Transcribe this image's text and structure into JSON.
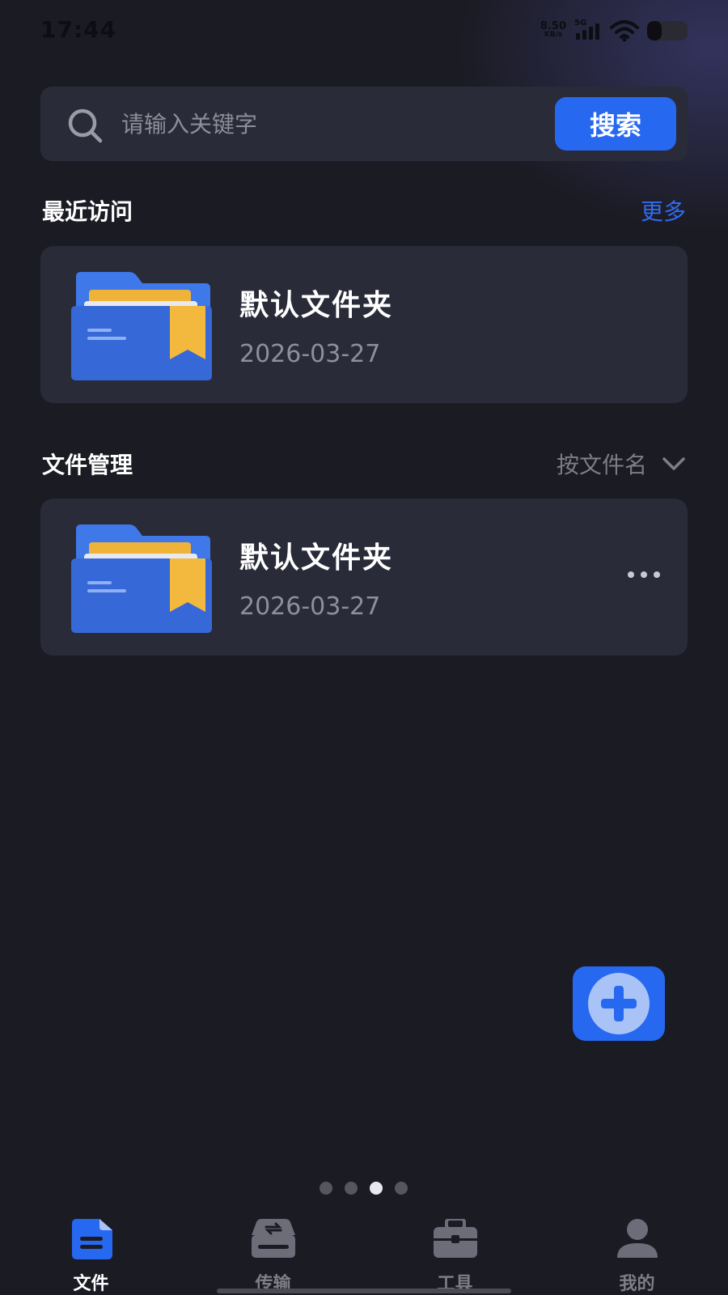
{
  "status_bar": {
    "time": "17:44",
    "net_speed_value": "8.50",
    "net_speed_unit": "KB/s",
    "network_type": "5G",
    "battery_fraction": 0.35
  },
  "search": {
    "placeholder": "请输入关键字",
    "button_label": "搜索"
  },
  "recent": {
    "title": "最近访问",
    "more_label": "更多",
    "items": [
      {
        "name": "默认文件夹",
        "date": "2026-03-27",
        "icon": "folder-icon"
      }
    ]
  },
  "files": {
    "title": "文件管理",
    "sort_label": "按文件名",
    "items": [
      {
        "name": "默认文件夹",
        "date": "2026-03-27",
        "icon": "folder-icon"
      }
    ]
  },
  "pager": {
    "count": 4,
    "active_index": 2
  },
  "bottom_nav": {
    "items": [
      {
        "label": "文件",
        "icon": "document-icon",
        "active": true
      },
      {
        "label": "传输",
        "icon": "transfer-icon",
        "active": false
      },
      {
        "label": "工具",
        "icon": "toolbox-icon",
        "active": false
      },
      {
        "label": "我的",
        "icon": "user-icon",
        "active": false
      }
    ]
  },
  "colors": {
    "background": "#1b1b24",
    "card": "#2a2b38",
    "accent": "#2768f0",
    "link": "#2f6df0",
    "muted_text": "#8e8f9a"
  }
}
